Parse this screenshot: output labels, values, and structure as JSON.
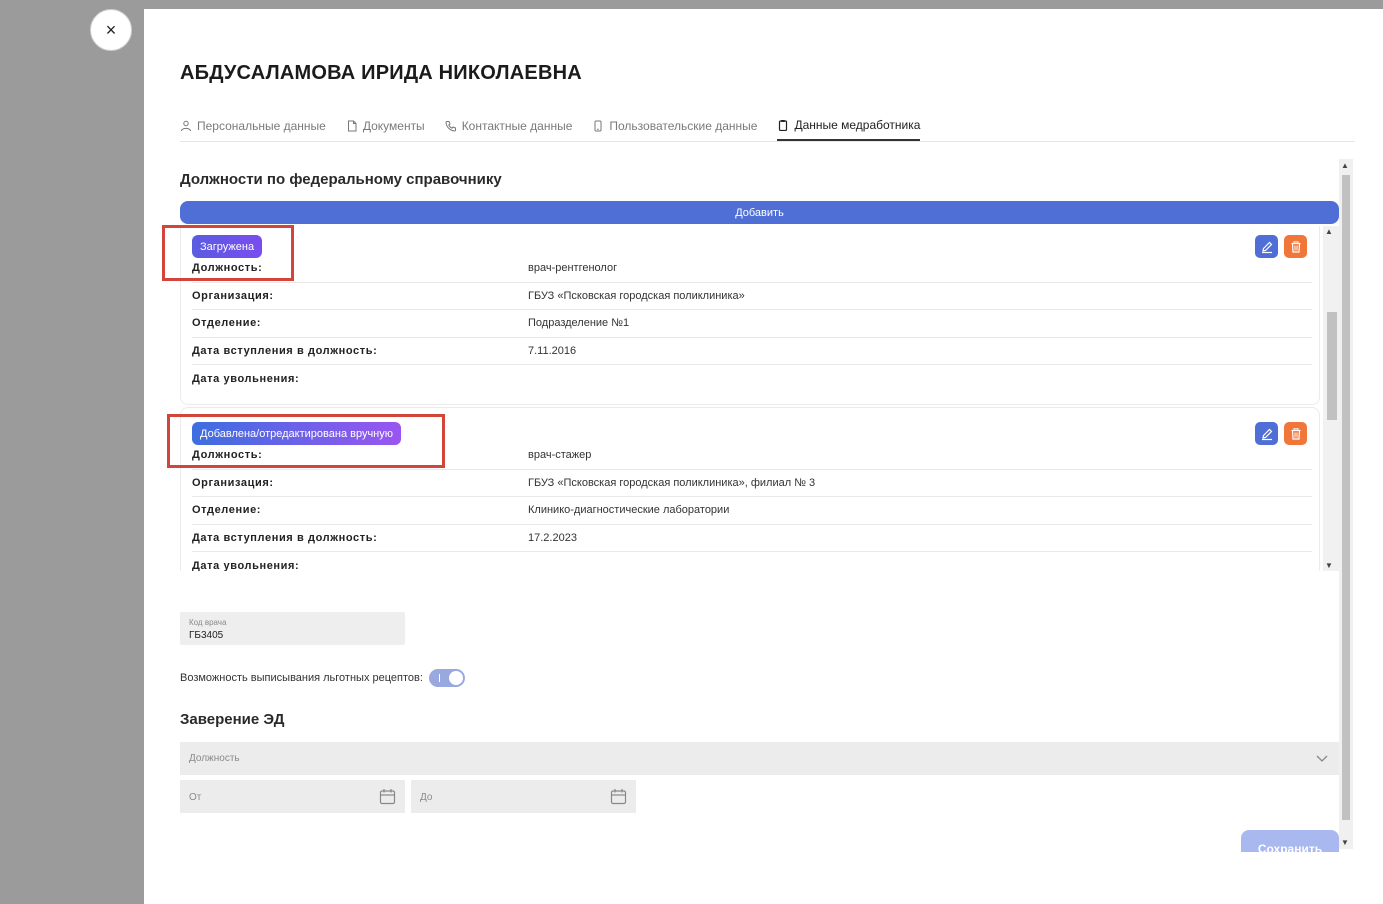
{
  "close": {
    "label": "×"
  },
  "title": "АБДУСАЛАМОВА ИРИДА НИКОЛАЕВНА",
  "tabs": [
    {
      "label": "Персональные данные",
      "icon": "user-icon"
    },
    {
      "label": "Документы",
      "icon": "document-icon"
    },
    {
      "label": "Контактные данные",
      "icon": "phone-icon"
    },
    {
      "label": "Пользовательские данные",
      "icon": "mobile-icon"
    },
    {
      "label": "Данные медработника",
      "icon": "clipboard-icon",
      "active": true
    }
  ],
  "positions": {
    "heading": "Должности по федеральному справочнику",
    "add_label": "Добавить",
    "cards": [
      {
        "badge": "Загружена",
        "rows": [
          {
            "key": "Должность:",
            "value": "врач-рентгенолог"
          },
          {
            "key": "Организация:",
            "value": "ГБУЗ «Псковская городская поликлиника»"
          },
          {
            "key": "Отделение:",
            "value": "Подразделение №1"
          },
          {
            "key": "Дата вступления в должность:",
            "value": "7.11.2016"
          },
          {
            "key": "Дата увольнения:",
            "value": ""
          }
        ]
      },
      {
        "badge": "Добавлена/отредактирована вручную",
        "rows": [
          {
            "key": "Должность:",
            "value": "врач-стажер"
          },
          {
            "key": "Организация:",
            "value": "ГБУЗ «Псковская городская поликлиника», филиал № 3"
          },
          {
            "key": "Отделение:",
            "value": "Клинико-диагностические лаборатории"
          },
          {
            "key": "Дата вступления в должность:",
            "value": "17.2.2023"
          },
          {
            "key": "Дата увольнения:",
            "value": ""
          }
        ]
      }
    ]
  },
  "doctor_code": {
    "label": "Код врача",
    "value": "ГБ3405"
  },
  "preferential": {
    "label": "Возможность выписывания льготных рецептов:",
    "enabled": true
  },
  "certification": {
    "heading": "Заверение ЭД",
    "position_placeholder": "Должность",
    "from_placeholder": "От",
    "to_placeholder": "До"
  },
  "save_label": "Сохранить",
  "colors": {
    "primary": "#4f6fd6",
    "danger": "#f0763a",
    "highlight": "#d1453b"
  }
}
